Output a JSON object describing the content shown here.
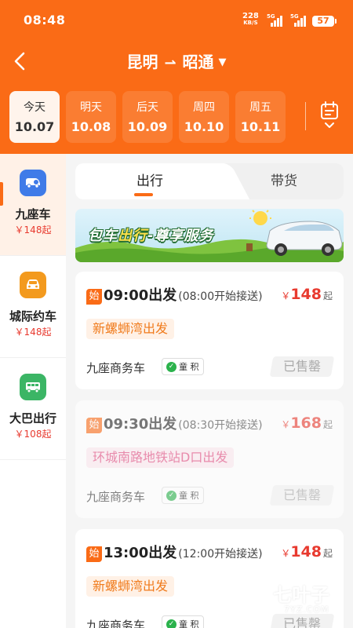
{
  "status_bar": {
    "time": "08:48",
    "net_speed": "228",
    "net_unit": "KB/S",
    "signal_1": "5G",
    "signal_2": "5G",
    "battery": "57"
  },
  "header": {
    "from_city": "昆明",
    "to_city": "昭通",
    "route_arrow": "⇀",
    "background_color": "#fa6b16"
  },
  "dates": [
    {
      "label": "今天",
      "date": "10.07",
      "active": true
    },
    {
      "label": "明天",
      "date": "10.08",
      "active": false
    },
    {
      "label": "后天",
      "date": "10.09",
      "active": false
    },
    {
      "label": "周四",
      "date": "10.10",
      "active": false
    },
    {
      "label": "周五",
      "date": "10.11",
      "active": false
    }
  ],
  "sidebar": {
    "items": [
      {
        "name": "九座车",
        "price": "￥148起",
        "icon": "van-icon",
        "color": "#3f7be8",
        "active": true
      },
      {
        "name": "城际约车",
        "price": "￥148起",
        "icon": "car-icon",
        "color": "#f39a1e",
        "active": false
      },
      {
        "name": "大巴出行",
        "price": "￥108起",
        "icon": "bus-icon",
        "color": "#3bb565",
        "active": false
      }
    ]
  },
  "tabs": {
    "travel": "出行",
    "goods": "带货"
  },
  "banner": {
    "text_part1": "包车",
    "text_part2": "出行",
    "text_part3": "-尊享服务"
  },
  "trips": [
    {
      "start_badge": "始",
      "departure": "09:00出发",
      "pickup": "(08:00开始接送)",
      "yen": "￥",
      "price": "148",
      "price_unit": "起",
      "station": "新螺蛳湾出发",
      "station_style": "orange",
      "vehicle": "九座商务车",
      "tags": "童 积",
      "status": "已售罄",
      "dim": false
    },
    {
      "start_badge": "始",
      "departure": "09:30出发",
      "pickup": "(08:30开始接送)",
      "yen": "￥",
      "price": "168",
      "price_unit": "起",
      "station": "环城南路地铁站D口出发",
      "station_style": "pink",
      "vehicle": "九座商务车",
      "tags": "童 积",
      "status": "已售罄",
      "dim": true
    },
    {
      "start_badge": "始",
      "departure": "13:00出发",
      "pickup": "(12:00开始接送)",
      "yen": "￥",
      "price": "148",
      "price_unit": "起",
      "station": "新螺蛳湾出发",
      "station_style": "orange",
      "vehicle": "九座商务车",
      "tags": "童 积",
      "status": "已售罄",
      "dim": false
    }
  ],
  "watermark": {
    "text": "七叶子",
    "url": "7YZ.COM"
  }
}
